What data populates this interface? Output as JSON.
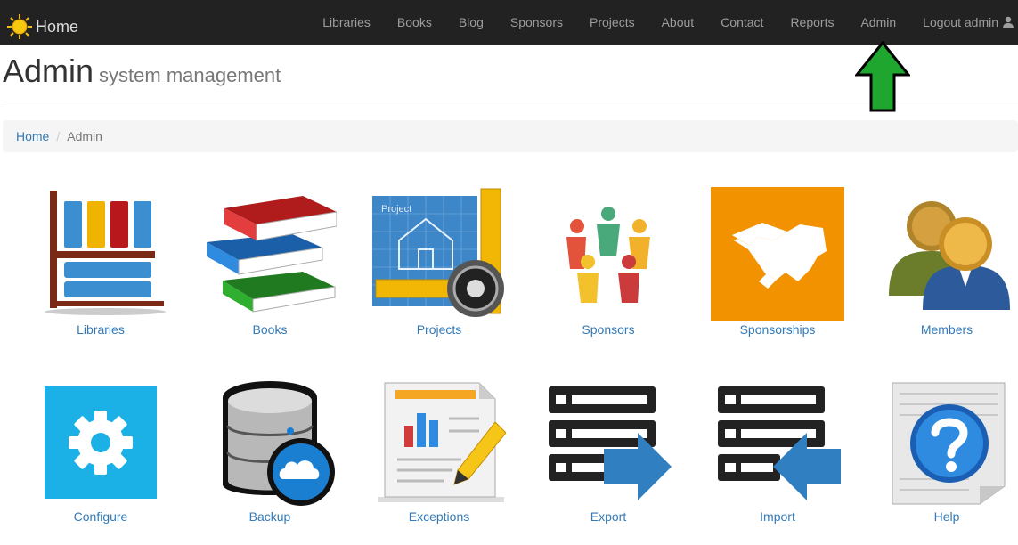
{
  "brand": {
    "label": "Home",
    "icon": "sun-icon"
  },
  "nav": {
    "items": [
      "Libraries",
      "Books",
      "Blog",
      "Sponsors",
      "Projects",
      "About",
      "Contact",
      "Reports",
      "Admin"
    ],
    "logout": "Logout admin",
    "logout_icon": "user-icon"
  },
  "header": {
    "title": "Admin",
    "subtitle": "system management"
  },
  "breadcrumb": {
    "home": "Home",
    "separator": "/",
    "current": "Admin"
  },
  "tiles": {
    "libraries": "Libraries",
    "books": "Books",
    "projects": "Projects",
    "sponsors": "Sponsors",
    "sponsorships": "Sponsorships",
    "members": "Members",
    "configure": "Configure",
    "backup": "Backup",
    "exceptions": "Exceptions",
    "export": "Export",
    "import": "Import",
    "help": "Help"
  },
  "annotation": {
    "icon": "green-up-arrow-icon",
    "color": "#1fa62e"
  },
  "colors": {
    "navbar": "#222222",
    "link": "#337ab7",
    "tile_orange": "#f39200",
    "tile_blue": "#1bb1e7"
  }
}
